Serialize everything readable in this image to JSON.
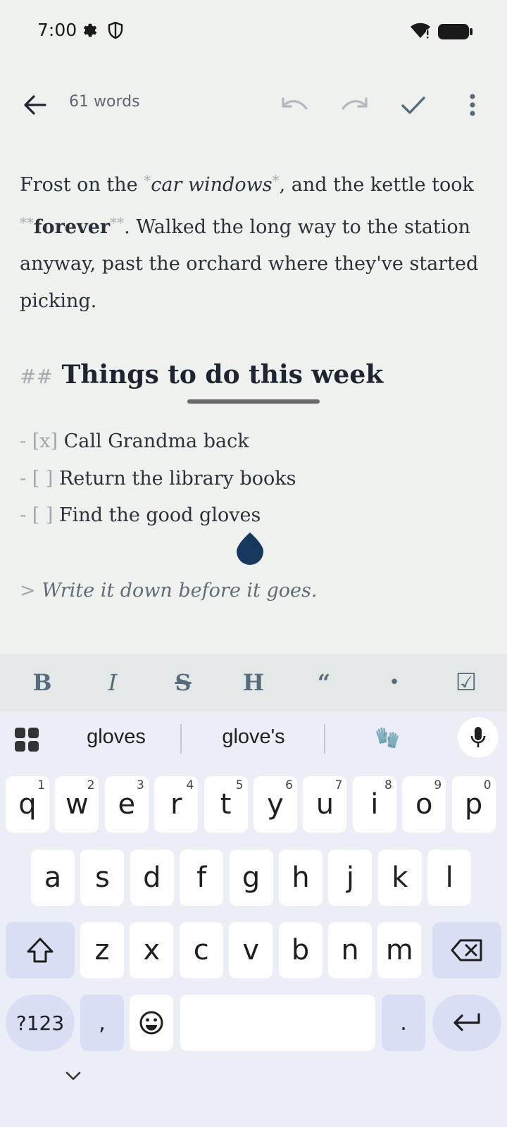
{
  "status": {
    "time": "7:00"
  },
  "toolbar": {
    "word_count": "61 words"
  },
  "editor": {
    "p1_a": "Frost on the ",
    "p1_mk1": "*",
    "p1_it": "car windows",
    "p1_mk2": "*",
    "p1_b": ", and the kettle took ",
    "p1_mk3": "**",
    "p1_bold": "forever",
    "p1_mk4": "**",
    "p1_c": ". Walked the long way to the station anyway, past the orchard where they've started picking.",
    "heading_marker": "##",
    "heading": "Things to do this week",
    "tasks": [
      {
        "marker": "- [x]",
        "text": "Call Grandma back"
      },
      {
        "marker": "- [ ]",
        "text": "Return the library books"
      },
      {
        "marker": "- [ ]",
        "text": "Find the good gloves"
      }
    ],
    "quote_marker": ">",
    "quote": "Write it down before it goes."
  },
  "format_bar": {
    "bold": "B",
    "italic": "I",
    "strike": "S",
    "heading": "H",
    "quote": "“",
    "bullet": "•",
    "checkbox": "☑"
  },
  "keyboard": {
    "suggestions": [
      "gloves",
      "glove's",
      "🧤"
    ],
    "row1": [
      {
        "k": "q",
        "s": "1"
      },
      {
        "k": "w",
        "s": "2"
      },
      {
        "k": "e",
        "s": "3"
      },
      {
        "k": "r",
        "s": "4"
      },
      {
        "k": "t",
        "s": "5"
      },
      {
        "k": "y",
        "s": "6"
      },
      {
        "k": "u",
        "s": "7"
      },
      {
        "k": "i",
        "s": "8"
      },
      {
        "k": "o",
        "s": "9"
      },
      {
        "k": "p",
        "s": "0"
      }
    ],
    "row2": [
      "a",
      "s",
      "d",
      "f",
      "g",
      "h",
      "j",
      "k",
      "l"
    ],
    "row3": [
      "z",
      "x",
      "c",
      "v",
      "b",
      "n",
      "m"
    ],
    "symbols": "?123",
    "comma": ",",
    "period": "."
  },
  "colors": {
    "background": "#eff1ef",
    "accent": "#17385c",
    "format_icons": "#566b7c"
  }
}
